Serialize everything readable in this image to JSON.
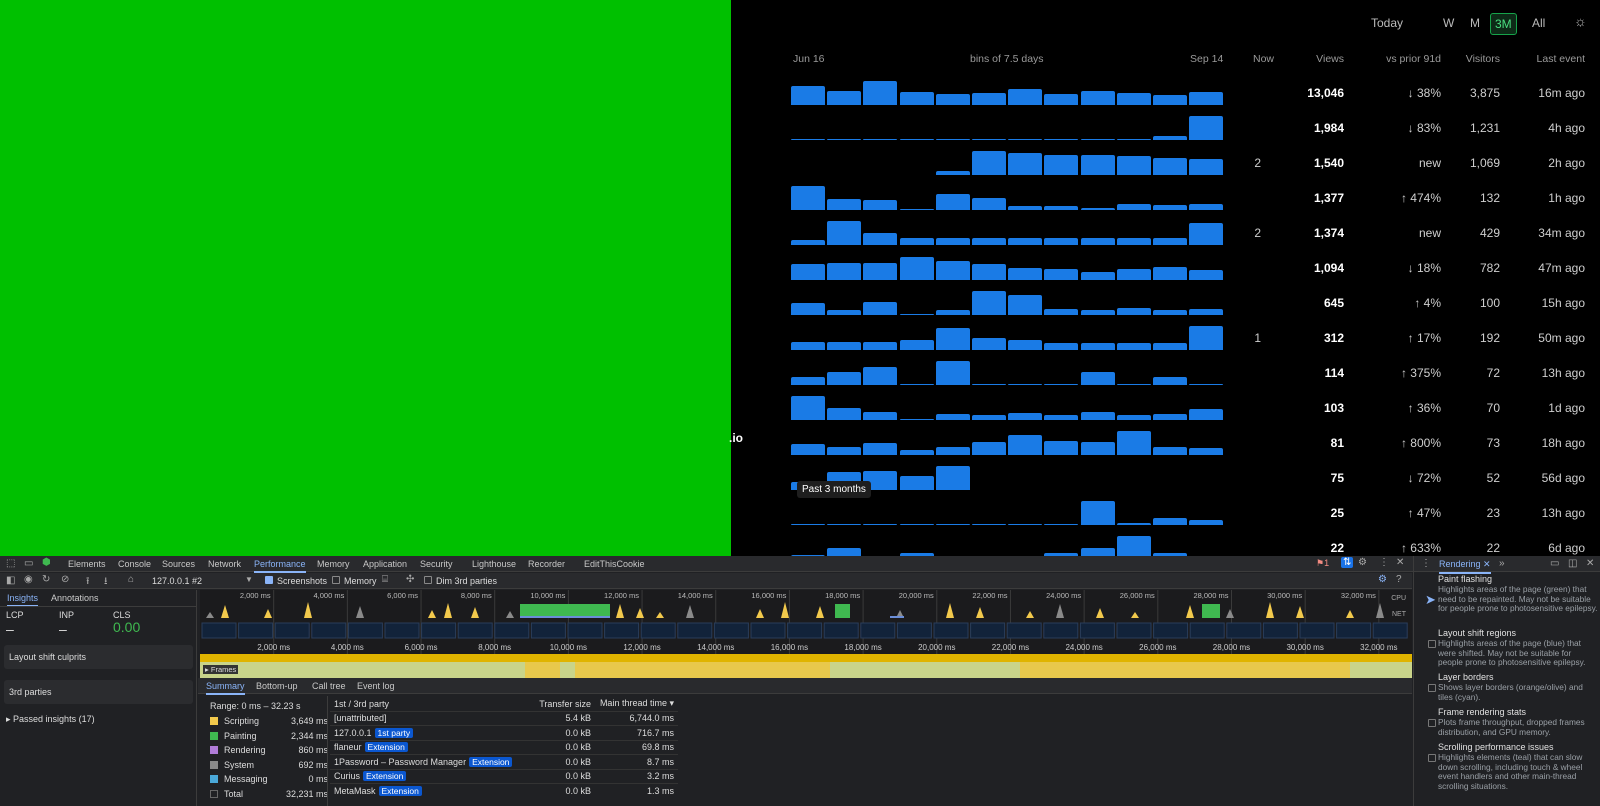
{
  "dashboard": {
    "ranges": [
      "Today",
      "W",
      "M",
      "3M",
      "All"
    ],
    "active_range": "3M",
    "theme_icon": "sun-icon",
    "headers": {
      "start": "Jun 16",
      "bins": "bins of 7.5 days",
      "end": "Sep 14",
      "now": "Now",
      "views": "Views",
      "vs_prior": "vs prior 91d",
      "visitors": "Visitors",
      "last_event": "Last event"
    },
    "partial_label": ".io",
    "tooltip": "Past 3 months",
    "rows": [
      {
        "now": "",
        "views": "13,046",
        "change": "↓ 38%",
        "visitors": "3,875",
        "last": "16m ago",
        "bins": [
          0.8,
          0.6,
          1.0,
          0.55,
          0.45,
          0.5,
          0.65,
          0.45,
          0.6,
          0.5,
          0.4,
          0.55
        ]
      },
      {
        "now": "",
        "views": "1,984",
        "change": "↓ 83%",
        "visitors": "1,231",
        "last": "4h ago",
        "bins": [
          0.04,
          0.04,
          0.04,
          0.04,
          0.04,
          0.04,
          0.04,
          0.04,
          0.04,
          0.04,
          0.15,
          1.0
        ]
      },
      {
        "now": "2",
        "views": "1,540",
        "change": "new",
        "visitors": "1,069",
        "last": "2h ago",
        "bins": [
          0,
          0,
          0,
          0,
          0.15,
          1.0,
          0.9,
          0.85,
          0.85,
          0.8,
          0.7,
          0.65
        ]
      },
      {
        "now": "",
        "views": "1,377",
        "change": "↑ 474%",
        "visitors": "132",
        "last": "1h ago",
        "bins": [
          1.0,
          0.45,
          0.4,
          0.05,
          0.65,
          0.5,
          0.15,
          0.15,
          0.1,
          0.25,
          0.2,
          0.25
        ]
      },
      {
        "now": "2",
        "views": "1,374",
        "change": "new",
        "visitors": "429",
        "last": "34m ago",
        "bins": [
          0.2,
          1.0,
          0.5,
          0.3,
          0.3,
          0.3,
          0.3,
          0.3,
          0.3,
          0.3,
          0.3,
          0.9
        ]
      },
      {
        "now": "",
        "views": "1,094",
        "change": "↓ 18%",
        "visitors": "782",
        "last": "47m ago",
        "bins": [
          0.65,
          0.7,
          0.7,
          0.95,
          0.8,
          0.65,
          0.5,
          0.45,
          0.35,
          0.45,
          0.55,
          0.4
        ]
      },
      {
        "now": "",
        "views": "645",
        "change": "↑ 4%",
        "visitors": "100",
        "last": "15h ago",
        "bins": [
          0.5,
          0.2,
          0.55,
          0.05,
          0.2,
          1.0,
          0.85,
          0.25,
          0.2,
          0.3,
          0.2,
          0.25
        ]
      },
      {
        "now": "1",
        "views": "312",
        "change": "↑ 17%",
        "visitors": "192",
        "last": "50m ago",
        "bins": [
          0.35,
          0.35,
          0.35,
          0.4,
          0.9,
          0.5,
          0.4,
          0.3,
          0.3,
          0.3,
          0.3,
          1.0
        ]
      },
      {
        "now": "",
        "views": "114",
        "change": "↑ 375%",
        "visitors": "72",
        "last": "13h ago",
        "bins": [
          0.35,
          0.55,
          0.75,
          0.05,
          1.0,
          0.05,
          0.05,
          0.05,
          0.55,
          0.05,
          0.35,
          0.05
        ]
      },
      {
        "now": "",
        "views": "103",
        "change": "↑ 36%",
        "visitors": "70",
        "last": "1d ago",
        "bins": [
          1.0,
          0.5,
          0.35,
          0.05,
          0.25,
          0.2,
          0.3,
          0.2,
          0.35,
          0.2,
          0.25,
          0.45
        ]
      },
      {
        "now": "",
        "views": "81",
        "change": "↑ 800%",
        "visitors": "73",
        "last": "18h ago",
        "bins": [
          0.45,
          0.35,
          0.5,
          0.2,
          0.35,
          0.55,
          0.85,
          0.6,
          0.55,
          1.0,
          0.35,
          0.3
        ]
      },
      {
        "now": "",
        "views": "75",
        "change": "↓ 72%",
        "visitors": "52",
        "last": "56d ago",
        "bins": [
          0.35,
          0.75,
          0.8,
          0.6,
          1.0,
          0,
          0,
          0,
          0,
          0,
          0,
          0
        ]
      },
      {
        "now": "",
        "views": "25",
        "change": "↑ 47%",
        "visitors": "23",
        "last": "13h ago",
        "bins": [
          0.05,
          0.05,
          0.05,
          0.05,
          0.05,
          0.05,
          0.05,
          0.05,
          1.0,
          0.1,
          0.3,
          0.2
        ]
      },
      {
        "now": "",
        "views": "22",
        "change": "↑ 633%",
        "visitors": "22",
        "last": "6d ago",
        "bins": [
          0.2,
          0.5,
          0.1,
          0.3,
          0.1,
          0.1,
          0.1,
          0.3,
          0.5,
          1.0,
          0.3,
          0.1
        ]
      }
    ]
  },
  "devtools": {
    "tabs": [
      "Elements",
      "Console",
      "Sources",
      "Network",
      "Performance",
      "Memory",
      "Application",
      "Security",
      "Lighthouse",
      "Recorder",
      "EditThisCookie"
    ],
    "active_tab": "Performance",
    "error_count": "1",
    "toolbar": {
      "target": "127.0.0.1 #2",
      "screenshots": "Screenshots",
      "memory": "Memory",
      "dim3p": "Dim 3rd parties"
    },
    "left": {
      "tabs": [
        "Insights",
        "Annotations"
      ],
      "metrics": [
        {
          "label": "LCP",
          "value": "–"
        },
        {
          "label": "INP",
          "value": "–"
        },
        {
          "label": "CLS",
          "value": "0.00"
        }
      ],
      "cards": [
        "Layout shift culprits",
        "3rd parties"
      ],
      "passed": "Passed insights (17)"
    },
    "overview_ticks": [
      "2,000 ms",
      "4,000 ms",
      "6,000 ms",
      "8,000 ms",
      "10,000 ms",
      "12,000 ms",
      "14,000 ms",
      "16,000 ms",
      "18,000 ms",
      "20,000 ms",
      "22,000 ms",
      "24,000 ms",
      "26,000 ms",
      "28,000 ms",
      "30,000 ms",
      "32,000 ms"
    ],
    "ruler_ticks": [
      "2,000 ms",
      "4,000 ms",
      "6,000 ms",
      "8,000 ms",
      "10,000 ms",
      "12,000 ms",
      "14,000 ms",
      "16,000 ms",
      "18,000 ms",
      "20,000 ms",
      "22,000 ms",
      "24,000 ms",
      "26,000 ms",
      "28,000 ms",
      "30,000 ms",
      "32,000 ms"
    ],
    "cpu_label": "CPU",
    "net_label": "NET",
    "frames_label": "Frames",
    "bottom_tabs": [
      "Summary",
      "Bottom-up",
      "Call tree",
      "Event log"
    ],
    "summary": {
      "range": "Range: 0 ms – 32.23 s",
      "items": [
        {
          "label": "Scripting",
          "value": "3,649 ms",
          "color": "#f2c94c"
        },
        {
          "label": "Painting",
          "value": "2,344 ms",
          "color": "#3fb950"
        },
        {
          "label": "Rendering",
          "value": "860 ms",
          "color": "#b07cd8"
        },
        {
          "label": "System",
          "value": "692 ms",
          "color": "#8a8a8a"
        },
        {
          "label": "Messaging",
          "value": "0 ms",
          "color": "#4aa8d8"
        },
        {
          "label": "Total",
          "value": "32,231 ms",
          "color": "#202124"
        }
      ]
    },
    "party_table": {
      "headers": [
        "1st / 3rd party",
        "Transfer size",
        "Main thread time ▾"
      ],
      "rows": [
        {
          "name": "[unattributed]",
          "tag": "",
          "size": "5.4 kB",
          "time": "6,744.0 ms"
        },
        {
          "name": "127.0.0.1",
          "tag": "1st party",
          "size": "0.0 kB",
          "time": "716.7 ms"
        },
        {
          "name": "flaneur",
          "tag": "Extension",
          "size": "0.0 kB",
          "time": "69.8 ms"
        },
        {
          "name": "1Password – Password Manager",
          "tag": "Extension",
          "size": "0.0 kB",
          "time": "8.7 ms"
        },
        {
          "name": "Curius",
          "tag": "Extension",
          "size": "0.0 kB",
          "time": "3.2 ms"
        },
        {
          "name": "MetaMask",
          "tag": "Extension",
          "size": "0.0 kB",
          "time": "1.3 ms"
        }
      ]
    },
    "rendering": {
      "title": "Rendering",
      "options": [
        {
          "title": "Paint flashing",
          "desc": "Highlights areas of the page (green) that need to be repainted. May not be suitable for people prone to photosensitive epilepsy."
        },
        {
          "title": "Layout shift regions",
          "desc": "Highlights areas of the page (blue) that were shifted. May not be suitable for people prone to photosensitive epilepsy."
        },
        {
          "title": "Layer borders",
          "desc": "Shows layer borders (orange/olive) and tiles (cyan)."
        },
        {
          "title": "Frame rendering stats",
          "desc": "Plots frame throughput, dropped frames distribution, and GPU memory."
        },
        {
          "title": "Scrolling performance issues",
          "desc": "Highlights elements (teal) that can slow down scrolling, including touch & wheel event handlers and other main-thread scrolling situations."
        }
      ]
    }
  }
}
